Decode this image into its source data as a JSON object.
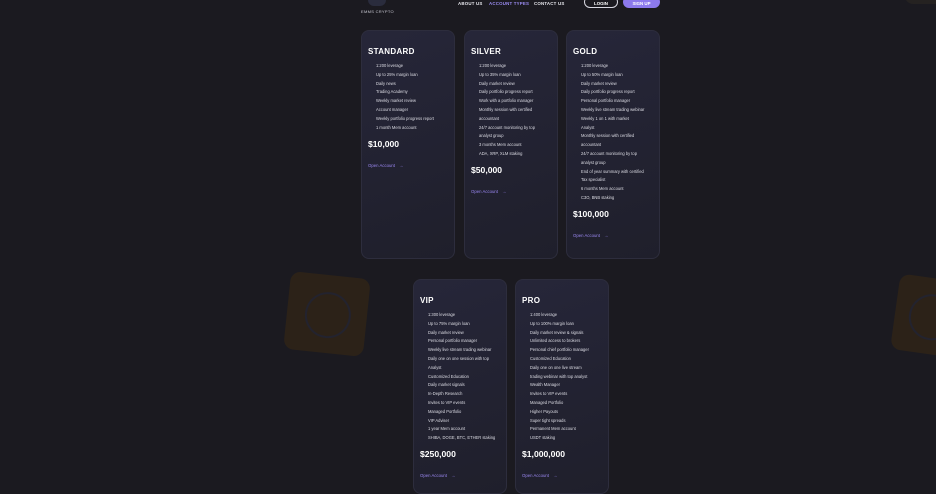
{
  "brand": {
    "name": "EMMS CRYPTO"
  },
  "nav": {
    "links": [
      "ABOUT US",
      "ACCOUNT TYPES",
      "CONTACT US"
    ],
    "login": "LOGIN",
    "signup": "SIGN UP"
  },
  "colors": {
    "accent": "#8c79ec",
    "link": "#9a87f2",
    "card": "#242436",
    "background": "#1b1a20"
  },
  "cards": [
    {
      "name": "STANDARD",
      "features": [
        "1:200 leverage",
        "Up to 25% margin loan",
        "Daily news",
        "Trading Academy",
        "Weekly market review",
        "Account manager",
        "Weekly portfolio progress report",
        "1 month Mem account"
      ],
      "price": "$10,000",
      "cta": "Open Account"
    },
    {
      "name": "SILVER",
      "features": [
        "1:200 leverage",
        "Up to 35% margin loan",
        "Daily market review",
        "Daily portfolio progress report",
        "Work with a portfolio manager",
        "Monthly session with certified",
        "accountant",
        "24/7 account monitoring by top",
        "analyst group",
        "3 months Mem account",
        "ADA, XRP, XLM staking"
      ],
      "price": "$50,000",
      "cta": "Open Account"
    },
    {
      "name": "GOLD",
      "features": [
        "1:200 leverage",
        "Up to 50% margin loan",
        "Daily market review",
        "Daily portfolio progress report",
        "Personal portfolio manager",
        "Weekly live stream trading webinar",
        "Weekly 1 on 1 with market",
        "Analyst",
        "Monthly session with certified",
        "accountant",
        "24/7 account monitoring by top",
        "analyst group",
        "End of year summary with certified",
        "Tax specialist",
        "6 months Mem account",
        "C3O, BNB staking"
      ],
      "price": "$100,000",
      "cta": "Open Account"
    },
    {
      "name": "VIP",
      "features": [
        "1:300 leverage",
        "Up to 75% margin loan",
        "Daily market review",
        "Personal portfolio manager",
        "Weekly live stream trading webinar",
        "Daily one on one session with top",
        "Analyst",
        "Customized Education",
        "Daily market signals",
        "In-Depth Research",
        "Invites to VIP events",
        "Managed Portfolio",
        "VIP Adviser",
        "1 year Mem account",
        "SHIBA, DOGE, BTC, ETHER staking"
      ],
      "price": "$250,000",
      "cta": "Open Account"
    },
    {
      "name": "PRO",
      "features": [
        "1:400 leverage",
        "Up to 100% margin loan",
        "Daily market review & signals",
        "Unlimited access to brokers",
        "Personal chief portfolio manager",
        "Customized Education",
        "Daily one on one live stream",
        "trading webinar with top analyst",
        "Wealth Manager",
        "Invites to VIP events",
        "Managed Portfolio",
        "Higher Payouts",
        "Super tight spreads",
        "Permanent Mem account",
        "USDT staking"
      ],
      "price": "$1,000,000",
      "cta": "Open Account"
    }
  ]
}
